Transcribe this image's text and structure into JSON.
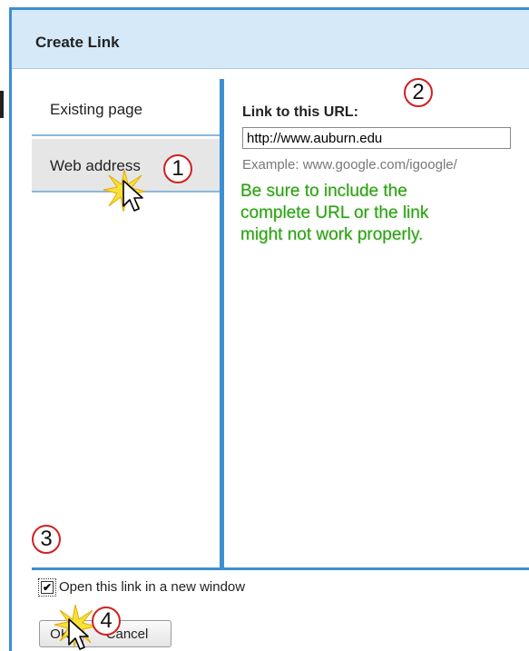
{
  "dialog": {
    "title": "Create Link"
  },
  "sidebar": {
    "items": [
      {
        "label": "Existing page"
      },
      {
        "label": "Web address"
      }
    ]
  },
  "content": {
    "url_label": "Link to this URL:",
    "url_value": "http://www.auburn.edu",
    "example": "Example: www.google.com/igoogle/",
    "note": "Be sure to include the complete URL or the link might not work properly."
  },
  "footer": {
    "checkbox_label": "Open this link in a new window",
    "checkbox_checked": true,
    "ok_label": "OK",
    "cancel_label": "Cancel"
  },
  "markers": [
    "1",
    "2",
    "3",
    "4"
  ],
  "colors": {
    "accent": "#3d8fd1",
    "marker": "#d21f1f",
    "note": "#2f9a1d"
  }
}
